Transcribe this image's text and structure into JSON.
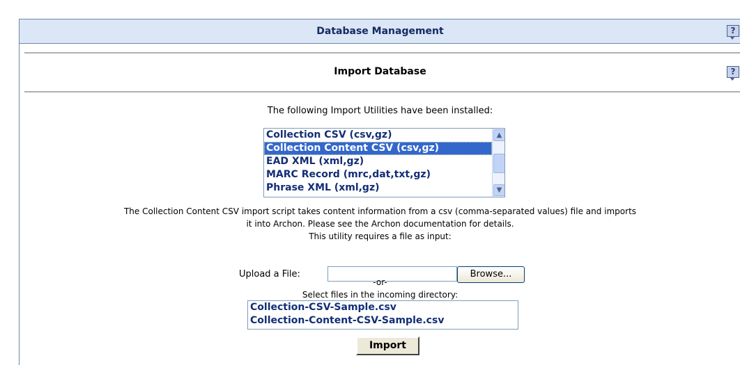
{
  "header": {
    "title": "Database Management"
  },
  "subheader": {
    "title": "Import Database"
  },
  "help_icon": {
    "glyph": "?",
    "icon": "help-icon"
  },
  "main": {
    "installed_text": "The following Import Utilities have been installed:",
    "utilities": [
      "Collection CSV (csv,gz)",
      "Collection Content CSV (csv,gz)",
      "EAD XML (xml,gz)",
      "MARC Record (mrc,dat,txt,gz)",
      "Phrase XML (xml,gz)"
    ],
    "selected_utility_index": 1,
    "description_line1": "The Collection Content CSV import script takes content information from a csv (comma-separated values) file and imports",
    "description_line2": "it into Archon. Please see the Archon documentation for details.",
    "requires_text": "This utility requires a file as input:",
    "upload_label": "Upload a File:",
    "browse_label": "Browse...",
    "or_text": "-or-",
    "incoming_text": "Select files in the incoming directory:",
    "incoming_files": [
      "Collection-CSV-Sample.csv",
      "Collection-Content-CSV-Sample.csv"
    ],
    "import_label": "Import"
  },
  "colors": {
    "header_bg": "#dbe6f6",
    "selected_bg": "#3367cc",
    "list_text": "#132e76"
  }
}
